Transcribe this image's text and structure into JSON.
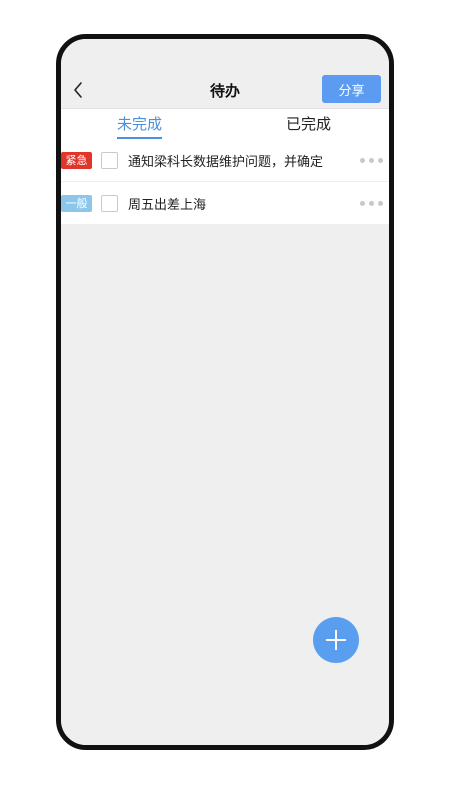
{
  "header": {
    "title": "待办",
    "share_label": "分享"
  },
  "tabs": [
    {
      "label": "未完成",
      "active": true
    },
    {
      "label": "已完成",
      "active": false
    }
  ],
  "todos": [
    {
      "tag": "紧急",
      "tag_color": "#e0352b",
      "text": "通知梁科长数据维护问题，并确定",
      "checked": false
    },
    {
      "tag": "一般",
      "tag_color": "#8cc6ea",
      "text": "周五出差上海",
      "checked": false
    }
  ],
  "colors": {
    "accent": "#5b9cf2",
    "tab_active": "#4a8fe0",
    "background": "#efefef"
  },
  "icons": {
    "back": "chevron-left-icon",
    "more": "more-dots-icon",
    "add": "plus-icon"
  }
}
